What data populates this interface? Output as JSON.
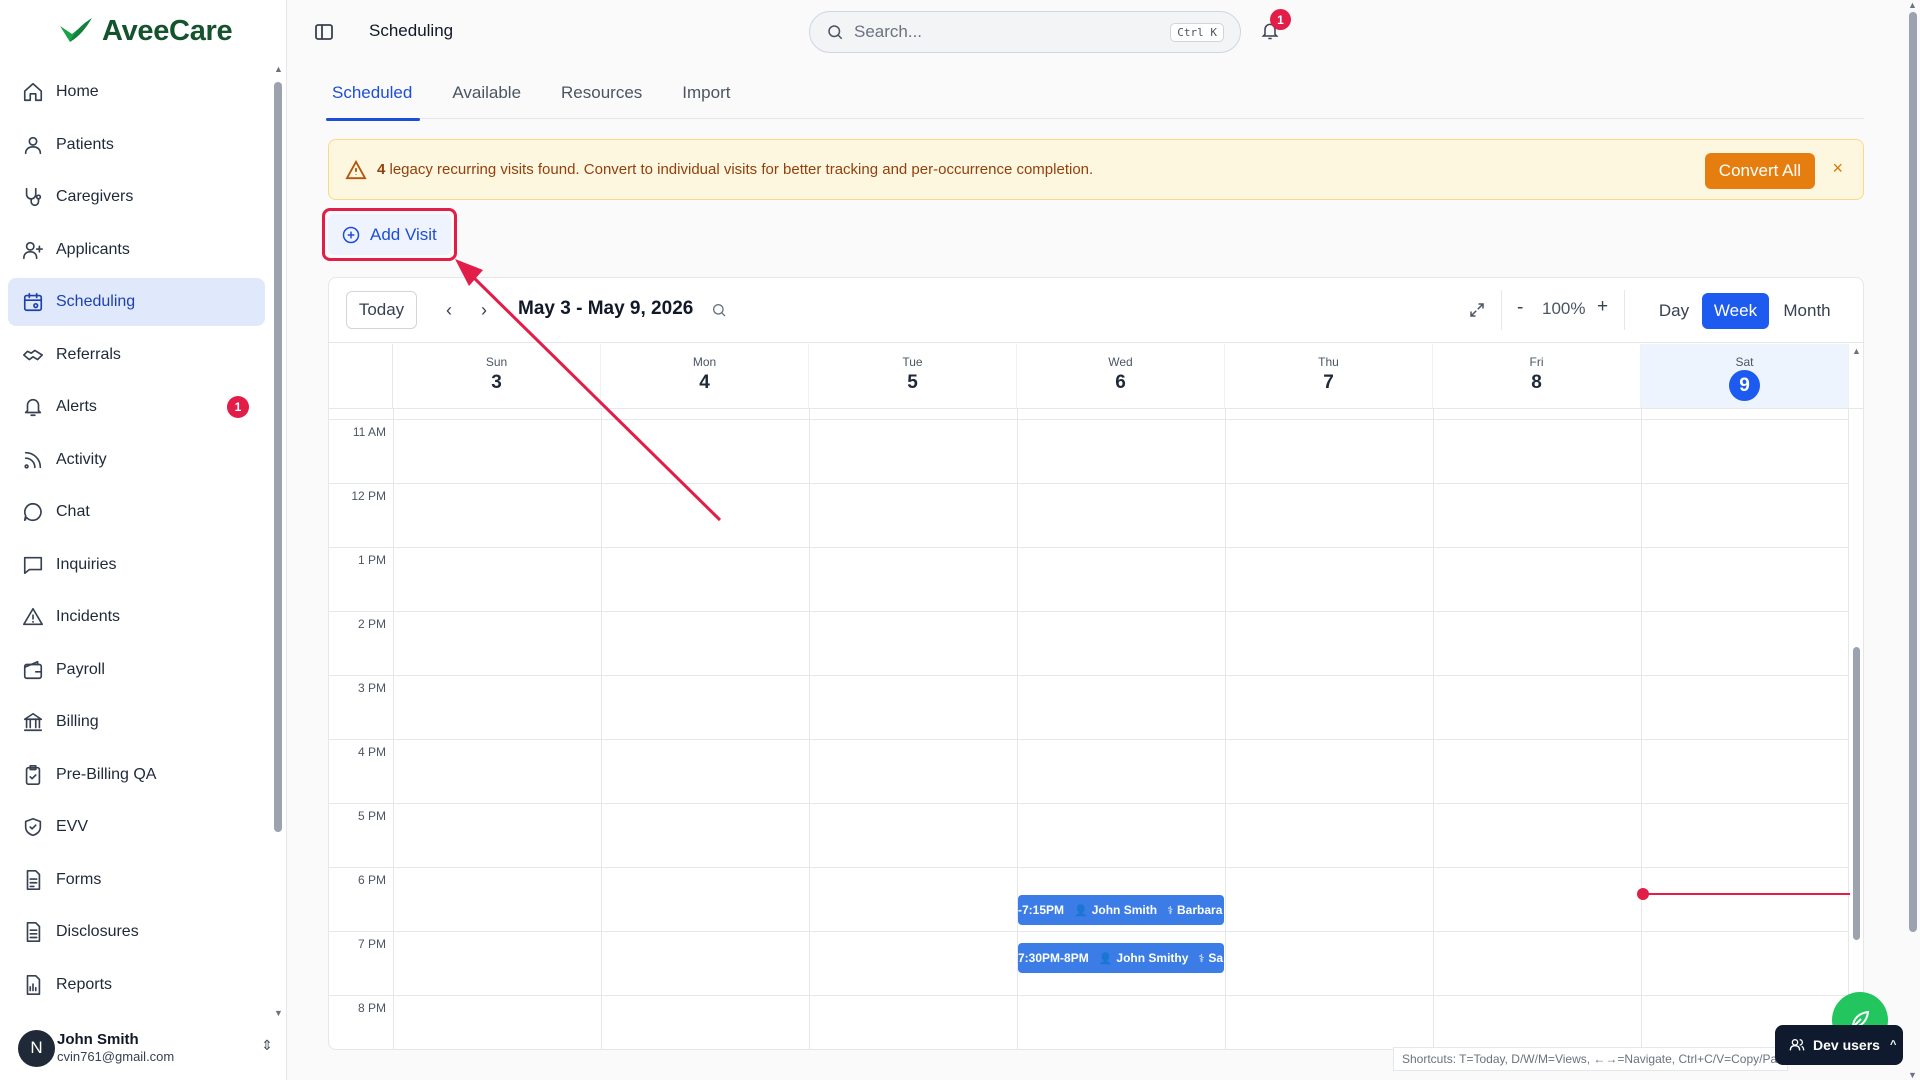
{
  "brand": {
    "name": "AveeCare"
  },
  "sidebar": {
    "items": [
      {
        "label": "Home",
        "icon": "home-icon"
      },
      {
        "label": "Patients",
        "icon": "user-icon"
      },
      {
        "label": "Caregivers",
        "icon": "stethoscope-icon"
      },
      {
        "label": "Applicants",
        "icon": "user-plus-icon"
      },
      {
        "label": "Scheduling",
        "icon": "calendar-icon",
        "active": true
      },
      {
        "label": "Referrals",
        "icon": "handshake-icon"
      },
      {
        "label": "Alerts",
        "icon": "bell-icon",
        "badge": "1"
      },
      {
        "label": "Activity",
        "icon": "activity-icon"
      },
      {
        "label": "Chat",
        "icon": "chat-icon"
      },
      {
        "label": "Inquiries",
        "icon": "message-square-icon"
      },
      {
        "label": "Incidents",
        "icon": "warning-icon"
      },
      {
        "label": "Payroll",
        "icon": "wallet-icon"
      },
      {
        "label": "Billing",
        "icon": "bank-icon"
      },
      {
        "label": "Pre-Billing QA",
        "icon": "clipboard-check-icon"
      },
      {
        "label": "EVV",
        "icon": "shield-check-icon"
      },
      {
        "label": "Forms",
        "icon": "form-icon"
      },
      {
        "label": "Disclosures",
        "icon": "document-icon"
      },
      {
        "label": "Reports",
        "icon": "report-icon"
      }
    ]
  },
  "user": {
    "initial": "N",
    "name": "John Smith",
    "email": "cvin761@gmail.com"
  },
  "topbar": {
    "title": "Scheduling",
    "search_placeholder": "Search...",
    "search_shortcut": "Ctrl K",
    "notification_count": "1"
  },
  "tabs": [
    {
      "label": "Scheduled",
      "active": true
    },
    {
      "label": "Available"
    },
    {
      "label": "Resources"
    },
    {
      "label": "Import"
    }
  ],
  "banner": {
    "count": "4",
    "message": " legacy recurring visits found. Convert to individual visits for better tracking and per-occurrence completion.",
    "action": "Convert All",
    "close": "×"
  },
  "add_visit": {
    "label": "Add Visit"
  },
  "calendar": {
    "today_label": "Today",
    "range": "May 3 - May 9, 2026",
    "zoom": {
      "minus": "-",
      "value": "100%",
      "plus": "+"
    },
    "views": {
      "day": "Day",
      "week": "Week",
      "month": "Month"
    },
    "active_view": "Week",
    "days": [
      {
        "name": "Sun",
        "num": "3"
      },
      {
        "name": "Mon",
        "num": "4"
      },
      {
        "name": "Tue",
        "num": "5"
      },
      {
        "name": "Wed",
        "num": "6"
      },
      {
        "name": "Thu",
        "num": "7"
      },
      {
        "name": "Fri",
        "num": "8"
      },
      {
        "name": "Sat",
        "num": "9",
        "today": true
      }
    ],
    "hours": [
      "11 AM",
      "12 PM",
      "1 PM",
      "2 PM",
      "3 PM",
      "4 PM",
      "5 PM",
      "6 PM",
      "7 PM",
      "8 PM"
    ],
    "visits": [
      {
        "time": "-7:15PM",
        "patient": "John Smith",
        "caregiver": "Barbara"
      },
      {
        "time": "7:30PM-8PM",
        "patient": "John Smithy",
        "caregiver": "Sa"
      }
    ]
  },
  "footer": {
    "shortcuts": "Shortcuts: T=Today, D/W/M=Views, ←→=Navigate, Ctrl+C/V=Copy/Paste",
    "dev_users": "Dev users"
  },
  "colors": {
    "accent": "#1d5bf0",
    "brand": "#14532d",
    "alert": "#e11d48",
    "warning": "#e57e0e",
    "visit": "#3b7ce6"
  }
}
